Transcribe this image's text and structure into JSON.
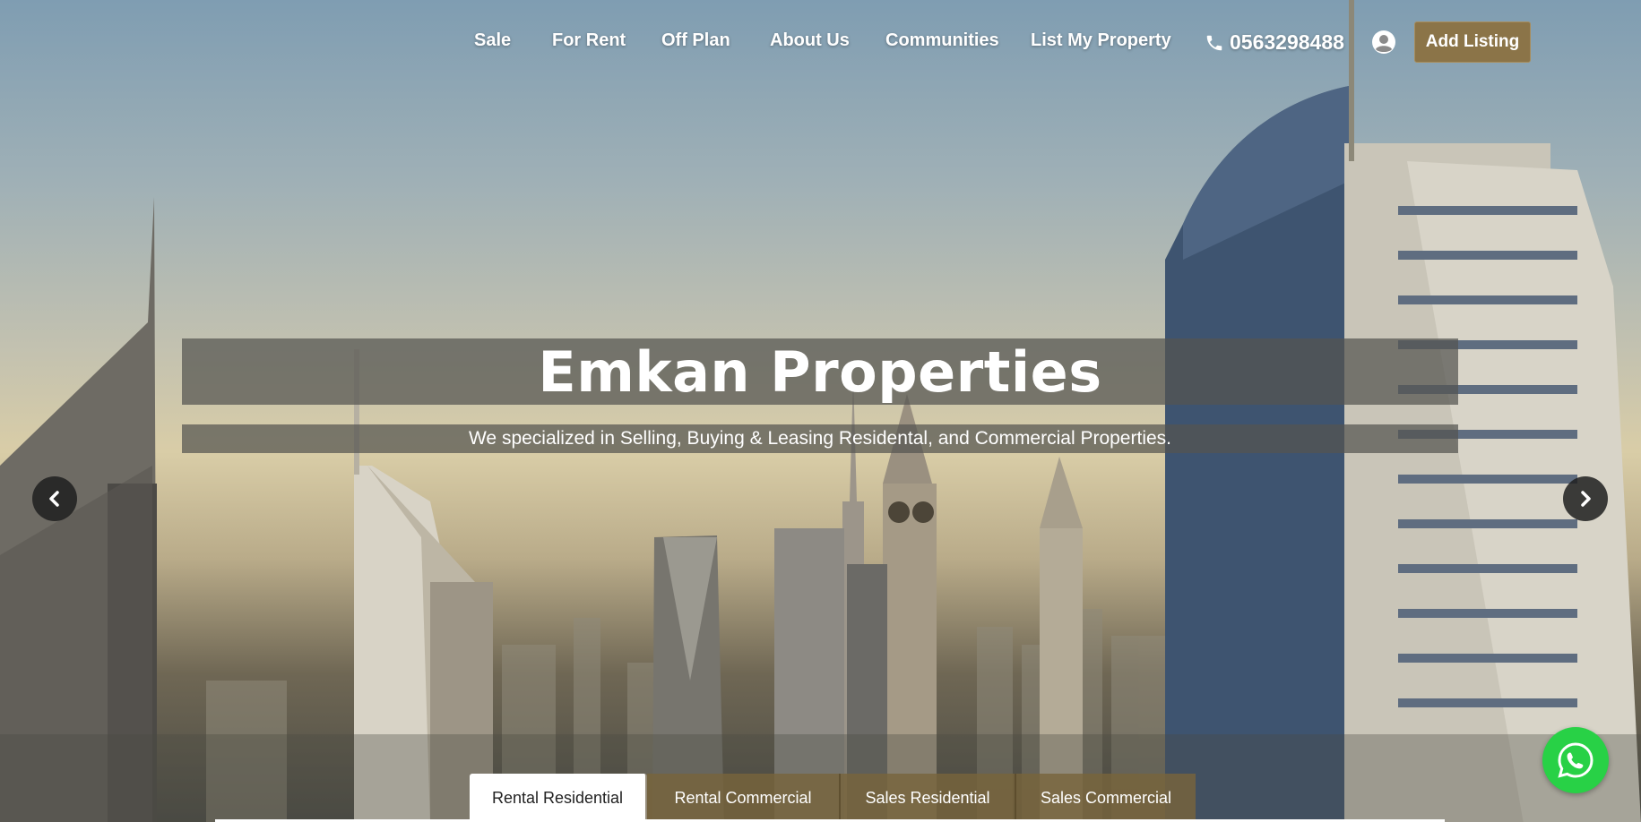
{
  "nav": {
    "items": [
      {
        "label": "Sale"
      },
      {
        "label": "For Rent"
      },
      {
        "label": "Off Plan"
      },
      {
        "label": "About Us"
      },
      {
        "label": "Communities"
      },
      {
        "label": "List My Property"
      }
    ],
    "phone": "0563298488",
    "add_listing_label": "Add Listing"
  },
  "hero": {
    "title": "Emkan Properties",
    "subtitle": "We specialized in Selling, Buying & Leasing Residental, and Commercial Properties."
  },
  "tabs": [
    {
      "label": "Rental Residential",
      "active": true
    },
    {
      "label": "Rental Commercial",
      "active": false
    },
    {
      "label": "Sales Residential",
      "active": false
    },
    {
      "label": "Sales Commercial",
      "active": false
    }
  ],
  "colors": {
    "accent": "#8b7448",
    "whatsapp": "#28d146"
  },
  "icons": {
    "phone": "phone-icon",
    "user": "user-circle-icon",
    "prev": "chevron-left-icon",
    "next": "chevron-right-icon",
    "whatsapp": "whatsapp-icon"
  }
}
